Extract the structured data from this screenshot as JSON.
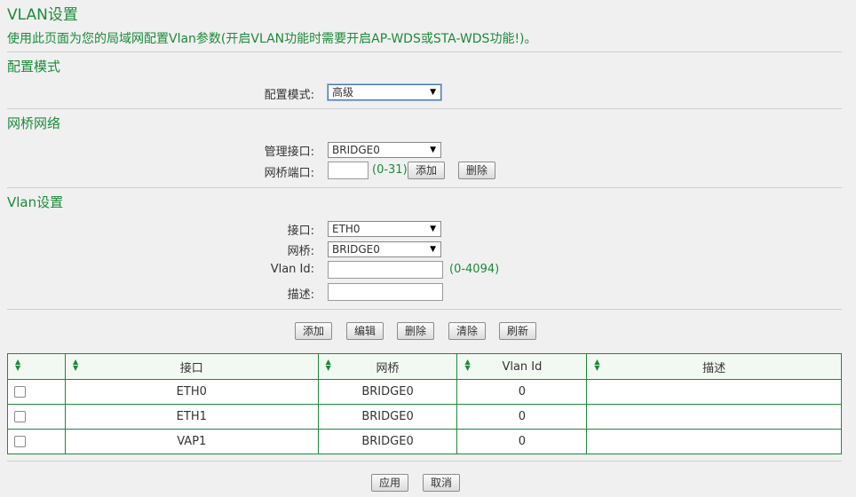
{
  "page": {
    "title": "VLAN设置",
    "description": "使用此页面为您的局域网配置Vlan参数(开启VLAN功能时需要开启AP-WDS或STA-WDS功能!)。"
  },
  "config_mode": {
    "section": "配置模式",
    "label": "配置模式:",
    "value": "高级"
  },
  "bridge": {
    "section": "网桥网络",
    "mgmt_label": "管理接口:",
    "mgmt_value": "BRIDGE0",
    "port_label": "网桥端口:",
    "port_value": "",
    "port_hint": "(0-31)",
    "add_label": "添加",
    "delete_label": "删除"
  },
  "vlan": {
    "section": "Vlan设置",
    "iface_label": "接口:",
    "iface_value": "ETH0",
    "bridge_label": "网桥:",
    "bridge_value": "BRIDGE0",
    "id_label": "Vlan Id:",
    "id_value": "",
    "id_hint": "(0-4094)",
    "desc_label": "描述:",
    "desc_value": ""
  },
  "actions": {
    "add": "添加",
    "edit": "编辑",
    "delete": "删除",
    "clear": "清除",
    "refresh": "刷新"
  },
  "table": {
    "columns": [
      "",
      "接口",
      "网桥",
      "Vlan Id",
      "描述"
    ],
    "rows": [
      {
        "iface": "ETH0",
        "bridge": "BRIDGE0",
        "vlan_id": "0",
        "desc": ""
      },
      {
        "iface": "ETH1",
        "bridge": "BRIDGE0",
        "vlan_id": "0",
        "desc": ""
      },
      {
        "iface": "VAP1",
        "bridge": "BRIDGE0",
        "vlan_id": "0",
        "desc": ""
      }
    ]
  },
  "footer": {
    "apply": "应用",
    "cancel": "取消"
  },
  "icons": {
    "sort": "sort-icon",
    "dropdown": "chevron-down-icon"
  },
  "colors": {
    "accent": "#1d8a3a",
    "background": "#f0f0f0"
  }
}
